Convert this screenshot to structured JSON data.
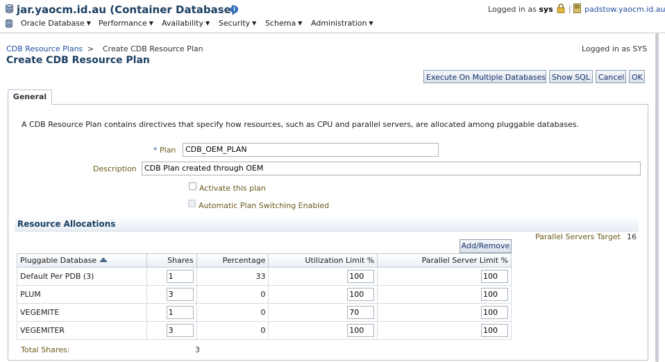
{
  "header": {
    "title": "jar.yaocm.id.au (Container Database)",
    "logged_in_prefix": "Logged in as",
    "logged_in_user": "sys",
    "host": "padstow.yaocm.id.au",
    "info_icon": "info-icon",
    "menus": [
      {
        "label": "Oracle Database"
      },
      {
        "label": "Performance"
      },
      {
        "label": "Availability"
      },
      {
        "label": "Security"
      },
      {
        "label": "Schema"
      },
      {
        "label": "Administration"
      }
    ]
  },
  "breadcrumb": {
    "parent": "CDB Resource Plans",
    "separator": ">",
    "current": "Create CDB Resource Plan"
  },
  "logged_in_as": "Logged in as SYS",
  "page_title": "Create CDB Resource Plan",
  "buttons": {
    "execute": "Execute On Multiple Databases",
    "show_sql": "Show SQL",
    "cancel": "Cancel",
    "ok": "OK"
  },
  "tabs": [
    {
      "label": "General"
    }
  ],
  "intro": "A CDB Resource Plan contains directives that specify how resources, such as CPU and parallel servers, are allocated among pluggable databases.",
  "form": {
    "plan_required_mark": "*",
    "plan_label": "Plan",
    "plan_value": "CDB_OEM_PLAN",
    "description_label": "Description",
    "description_value": "CDB Plan created through OEM",
    "activate_label": "Activate this plan",
    "activate_checked": false,
    "auto_switch_label": "Automatic Plan Switching Enabled",
    "auto_switch_checked": false
  },
  "resource_allocations": {
    "title": "Resource Allocations",
    "parallel_servers_target_label": "Parallel Servers Target",
    "parallel_servers_target_value": "16",
    "add_remove_label": "Add/Remove",
    "columns": [
      "Pluggable Database",
      "Shares",
      "Percentage",
      "Utilization Limit %",
      "Parallel Server Limit %"
    ],
    "rows": [
      {
        "pdb": "Default Per PDB (3)",
        "shares": "1",
        "percentage": "33",
        "util_limit": "100",
        "px_limit": "100"
      },
      {
        "pdb": "PLUM",
        "shares": "3",
        "percentage": "0",
        "util_limit": "100",
        "px_limit": "100"
      },
      {
        "pdb": "VEGEMITE",
        "shares": "1",
        "percentage": "0",
        "util_limit": "70",
        "px_limit": "100"
      },
      {
        "pdb": "VEGEMITER",
        "shares": "3",
        "percentage": "0",
        "util_limit": "100",
        "px_limit": "100"
      }
    ],
    "total_shares_label": "Total Shares:",
    "total_shares_value": "3"
  },
  "colors": {
    "title_blue": "#1b3f61",
    "link_blue": "#1f4e9b",
    "label_olive": "#6b5a1a"
  }
}
